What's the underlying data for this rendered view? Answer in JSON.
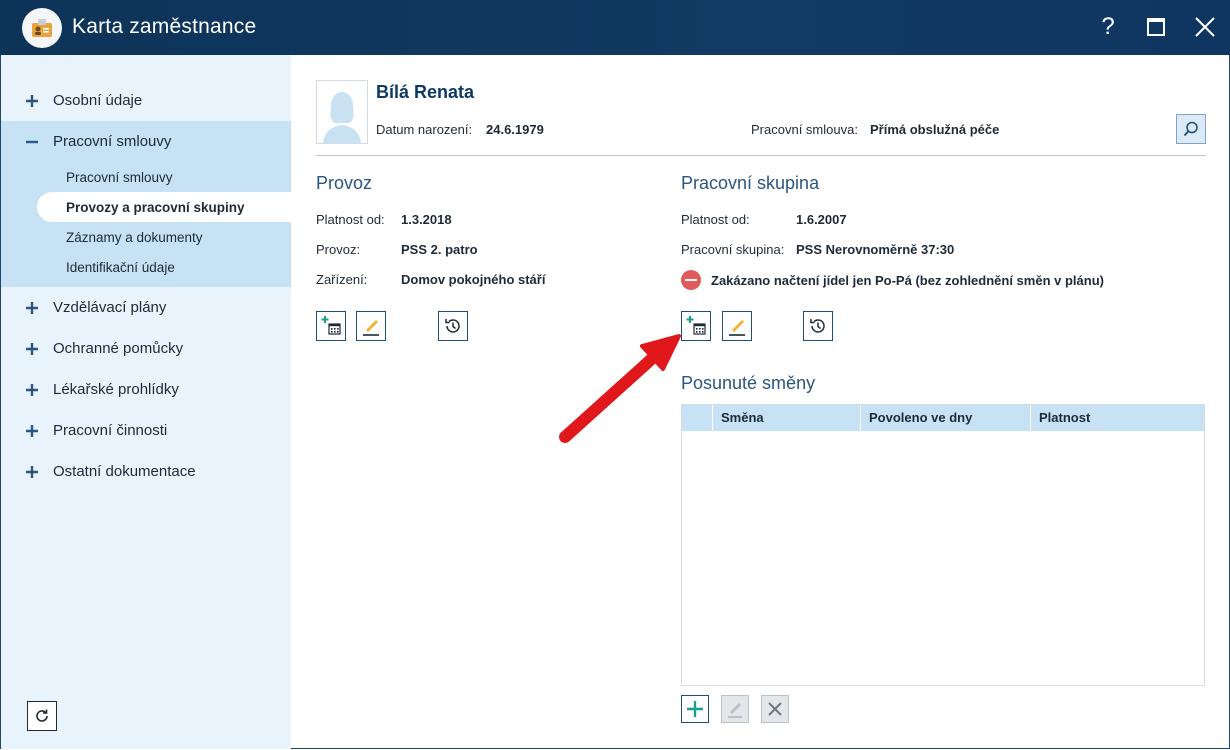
{
  "window": {
    "title": "Karta zaměstnance",
    "help_label": "?"
  },
  "sidebar": {
    "items": [
      {
        "label": "Osobní údaje",
        "sign": "+"
      },
      {
        "label": "Pracovní smlouvy",
        "sign": "−",
        "expanded": true
      },
      {
        "label": "Vzdělávací plány",
        "sign": "+"
      },
      {
        "label": "Ochranné pomůcky",
        "sign": "+"
      },
      {
        "label": "Lékařské prohlídky",
        "sign": "+"
      },
      {
        "label": "Pracovní činnosti",
        "sign": "+"
      },
      {
        "label": "Ostatní dokumentace",
        "sign": "+"
      }
    ],
    "subitems": [
      {
        "label": "Pracovní smlouvy"
      },
      {
        "label": "Provozy a pracovní skupiny",
        "active": true
      },
      {
        "label": "Záznamy a dokumenty"
      },
      {
        "label": "Identifikační údaje"
      }
    ]
  },
  "header": {
    "name": "Bílá Renata",
    "birth_label": "Datum narození:",
    "birth_value": "24.6.1979",
    "contract_label": "Pracovní smlouva:",
    "contract_value": "Přímá obslužná péče"
  },
  "provoz": {
    "title": "Provoz",
    "fields": [
      {
        "label": "Platnost od:",
        "value": "1.3.2018"
      },
      {
        "label": "Provoz:",
        "value": "PSS 2. patro"
      },
      {
        "label": "Zařízení:",
        "value": "Domov pokojného stáří"
      }
    ]
  },
  "skupina": {
    "title": "Pracovní skupina",
    "fields": [
      {
        "label": "Platnost od:",
        "value": "1.6.2007"
      },
      {
        "label": "Pracovní skupina:",
        "value": "PSS Nerovnoměrně 37:30"
      }
    ],
    "warning": "Zakázano načtení jídel jen Po-Pá (bez zohlednění směn v plánu)"
  },
  "posunute": {
    "title": "Posunuté směny",
    "columns": [
      "Směna",
      "Povoleno ve dny",
      "Platnost"
    ],
    "rows": []
  },
  "colors": {
    "titlebar": "#0f3660",
    "sidebar_bg": "#e9f3fb",
    "sidebar_group": "#c7e2f4",
    "accent": "#1e4f7a",
    "warning": "#e05a5a",
    "arrow": "#e0181b"
  }
}
